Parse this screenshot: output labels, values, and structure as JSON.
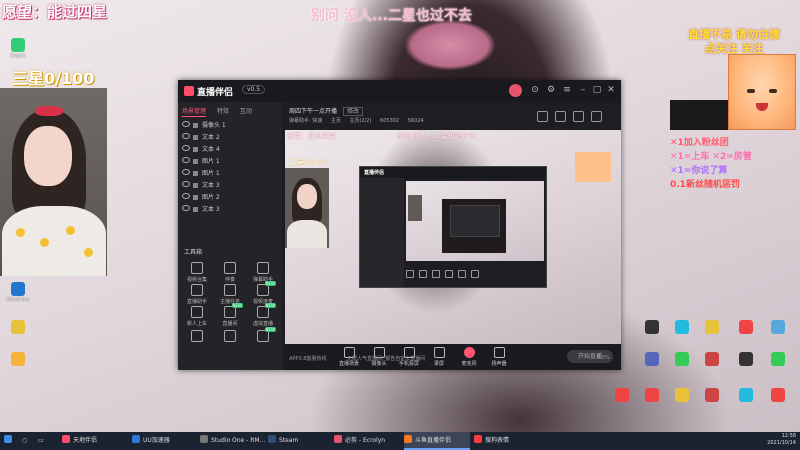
{
  "overlay": {
    "wish": "愿望：能过四星",
    "stars": "三星0/100",
    "banner": "别问 没人...二星也过不去",
    "promo_line1": "直播不易 请勿白嫖",
    "promo_line2": "点关注 关注",
    "rules": [
      "✕1加入粉丝团",
      "✕1=上车  ✕2=房管",
      "✕1=你说了算",
      "0.1新丝随机惩罚"
    ]
  },
  "desktop_icons": [
    {
      "label": "Copy1",
      "icon": "app-icon",
      "color": "#3c7"
    },
    {
      "label": "Onedrive",
      "icon": "cloud-icon",
      "color": "#27c"
    },
    {
      "label": "",
      "icon": "app-icon",
      "color": "#e8c23a"
    },
    {
      "label": "",
      "icon": "app-icon",
      "color": "#f5b33b"
    },
    {
      "label": "",
      "icon": "app-icon",
      "color": "#56b"
    },
    {
      "label": "",
      "icon": "app-icon",
      "color": "#e44"
    },
    {
      "label": "",
      "icon": "app-icon",
      "color": "#2bd"
    },
    {
      "label": "",
      "icon": "app-icon",
      "color": "#e8c23a"
    },
    {
      "label": "",
      "icon": "app-icon",
      "color": "#333"
    },
    {
      "label": "",
      "icon": "app-icon",
      "color": "#3c5"
    },
    {
      "label": "",
      "icon": "app-icon",
      "color": "#e44"
    },
    {
      "label": "",
      "icon": "app-icon",
      "color": "#e8c23a"
    },
    {
      "label": "",
      "icon": "app-icon",
      "color": "#2bd"
    },
    {
      "label": "",
      "icon": "app-icon",
      "color": "#5ad"
    },
    {
      "label": "",
      "icon": "app-icon",
      "color": "#e44"
    },
    {
      "label": "",
      "icon": "app-icon",
      "color": "#c44"
    }
  ],
  "app": {
    "name": "直播伴侣",
    "version": "v0.5",
    "left_tabs": [
      "场景管理",
      "特效",
      "互动"
    ],
    "layers": [
      "摄像头 1",
      "文本 2",
      "文本 4",
      "图片 1",
      "图片 1",
      "文本 3",
      "图片 2",
      "文本 3"
    ],
    "tools_title": "工具箱",
    "tools": [
      {
        "label": "视频合集",
        "badge": ""
      },
      {
        "label": "伴奏",
        "badge": ""
      },
      {
        "label": "弹幕助手",
        "badge": ""
      },
      {
        "label": "直播助手",
        "badge": ""
      },
      {
        "label": "主播任务",
        "badge": ""
      },
      {
        "label": "视频连麦",
        "badge": "NEW"
      },
      {
        "label": "新人上车",
        "badge": ""
      },
      {
        "label": "直播间",
        "badge": "NEW"
      },
      {
        "label": "虚拟直播",
        "badge": "NEW"
      },
      {
        "label": "",
        "badge": ""
      },
      {
        "label": "",
        "badge": ""
      },
      {
        "label": "",
        "badge": "NEW"
      }
    ],
    "stream_title": "周四下午一点开播",
    "stream_badge": "修改",
    "stats": [
      "弹幕助手: 快速",
      "主页",
      "主页(2/2)",
      "605302",
      "56024"
    ],
    "controls": [
      "直播场景",
      "摄像头",
      "手机投屏",
      "录屏",
      "麦克风",
      "扬声器"
    ],
    "start_label": "开始直播",
    "status_left": "APP3.8客服热线",
    "status_mid": "无限人气直播间, 报告自定义直播间",
    "status_right": "0.0%",
    "preview_wish": "愿望：能过四星",
    "preview_star": "三星0/100",
    "preview_banner": "别问 没人...二星也过不去",
    "nested_name": "直播伴侣"
  },
  "taskbar": {
    "items": [
      {
        "label": "天地伴侣",
        "color": "#ff4d6a",
        "active": false
      },
      {
        "label": "UU加速器",
        "color": "#2a7bd9",
        "active": false
      },
      {
        "label": "Studio One - RM...",
        "color": "#444",
        "active": false
      },
      {
        "label": "Steam",
        "color": "#1b2838",
        "active": false
      },
      {
        "label": "必剪 - Ecrolyn",
        "color": "#e8546b",
        "active": false
      },
      {
        "label": "斗鱼直播伴侣",
        "color": "#f47a20",
        "active": true
      },
      {
        "label": "搜狗表情",
        "color": "#ff3b3b",
        "active": false
      }
    ],
    "time": "12:58",
    "date": "2021/10/14"
  }
}
